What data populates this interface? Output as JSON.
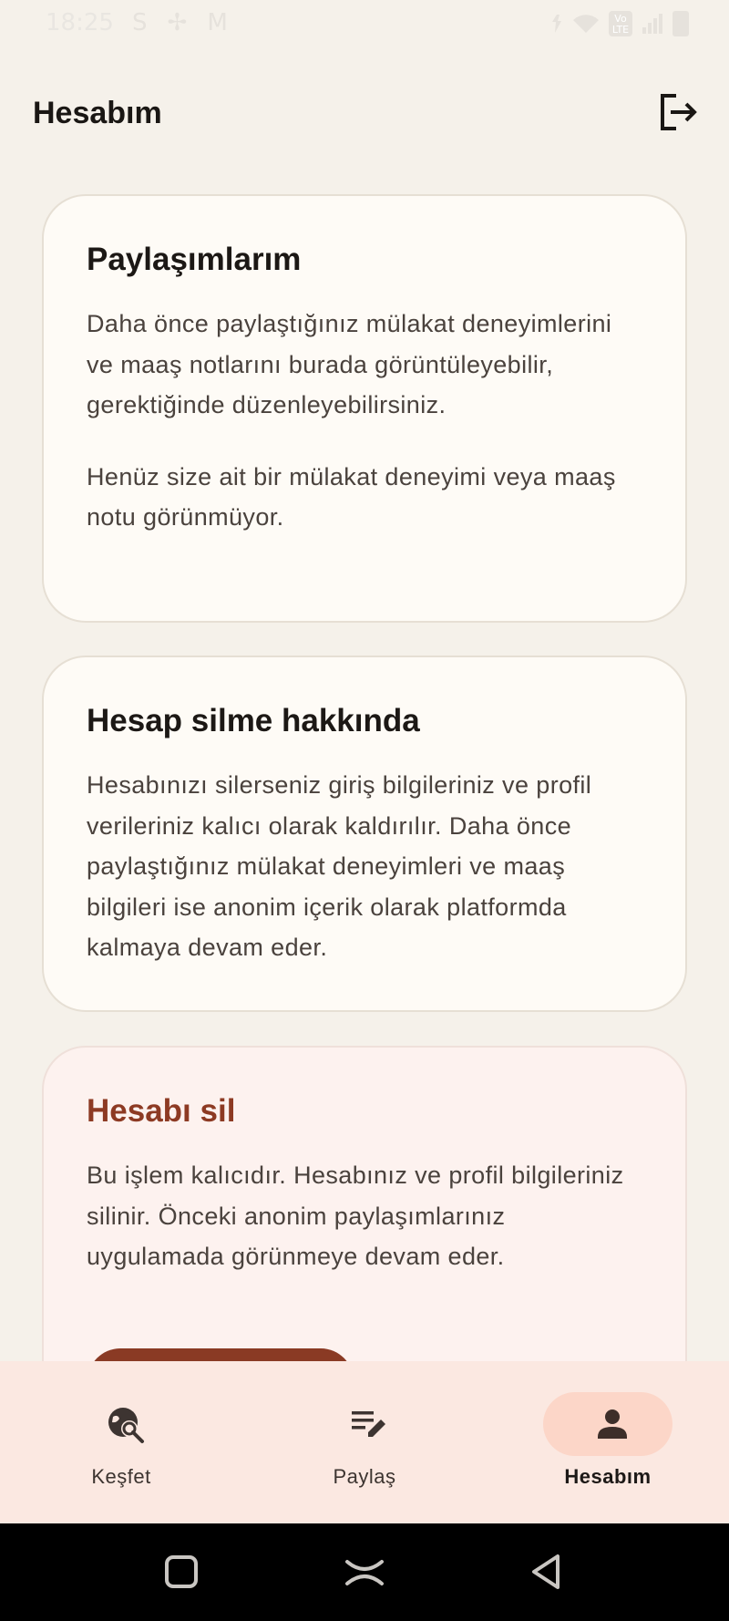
{
  "status_bar": {
    "time": "18:25",
    "app_icons": [
      "S",
      "✢",
      "M"
    ],
    "right_icons": [
      "vibrate-icon",
      "wifi-icon",
      "volte-icon",
      "signal-icon",
      "battery-icon"
    ],
    "volte_text": "Vo LTE"
  },
  "app_bar": {
    "title": "Hesabım",
    "logout_icon": "logout-icon"
  },
  "cards": {
    "shares": {
      "title": "Paylaşımlarım",
      "description": "Daha önce paylaştığınız mülakat deneyimlerini ve maaş notlarını burada görüntüleyebilir, gerektiğinde düzenleyebilirsiniz.",
      "empty_text": "Henüz size ait bir mülakat deneyimi veya maaş notu görünmüyor."
    },
    "deletion_info": {
      "title": "Hesap silme hakkında",
      "description": "Hesabınızı silerseniz giriş bilgileriniz ve profil verileriniz kalıcı olarak kaldırılır. Daha önce paylaştığınız mülakat deneyimleri ve maaş bilgileri ise anonim içerik olarak platformda kalmaya devam eder."
    },
    "delete_account": {
      "title": "Hesabı sil",
      "description": "Bu işlem kalıcıdır. Hesabınız ve profil bilgileriniz silinir. Önceki anonim paylaşımlarınız uygulamada görünmeye devam eder."
    }
  },
  "bottom_nav": {
    "items": [
      {
        "label": "Keşfet",
        "icon": "explore-search-icon",
        "active": false
      },
      {
        "label": "Paylaş",
        "icon": "edit-note-icon",
        "active": false
      },
      {
        "label": "Hesabım",
        "icon": "person-icon",
        "active": true
      }
    ]
  },
  "colors": {
    "background": "#f5f1ea",
    "card": "#fefbf6",
    "danger_card": "#fdf2ef",
    "danger_accent": "#8a3a24",
    "nav_background": "#fbe8e1",
    "nav_active_pill": "#fcd6c8"
  },
  "system_nav": {
    "buttons": [
      "recents-icon",
      "home-icon",
      "back-icon"
    ]
  }
}
